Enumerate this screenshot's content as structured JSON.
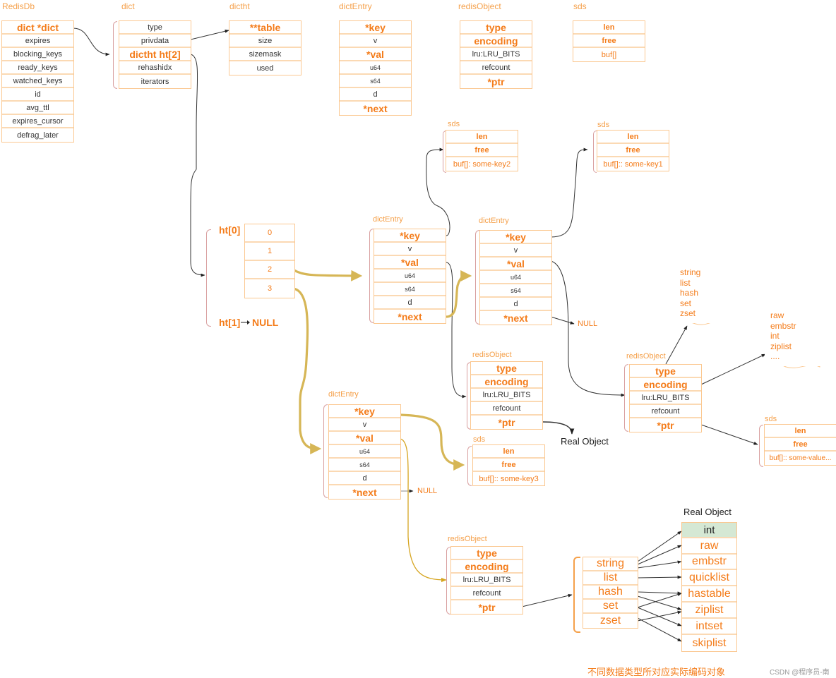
{
  "titles": {
    "redisdb": "RedisDb",
    "dict": "dict",
    "dictht": "dictht",
    "dictentry": "dictEntry",
    "redisobject": "redisObject",
    "sds": "sds"
  },
  "redisdb": [
    "dict  *dict",
    "expires",
    "blocking_keys",
    "ready_keys",
    "watched_keys",
    "id",
    "avg_ttl",
    "expires_cursor",
    "defrag_later"
  ],
  "dict": [
    "type",
    "privdata",
    "dictht ht[2]",
    "rehashidx",
    "iterators"
  ],
  "dictht": [
    "**table",
    "size",
    "sizemask",
    "used"
  ],
  "dictentry": [
    "*key",
    "v",
    "*val",
    "u64",
    "s64",
    "d",
    "*next"
  ],
  "redisobject": [
    "type",
    "encoding",
    "lru:LRU_BITS",
    "refcount",
    "*ptr"
  ],
  "sds": [
    "len",
    "free",
    "buf[]"
  ],
  "sds_key2": {
    "title": "sds",
    "rows": [
      "len",
      "free",
      "buf[]: some-key2"
    ]
  },
  "sds_key1": {
    "title": "sds",
    "rows": [
      "len",
      "free",
      "buf[]:: some-key1"
    ]
  },
  "sds_key3": {
    "title": "sds",
    "rows": [
      "len",
      "free",
      "buf[]:: some-key3"
    ]
  },
  "sds_value": {
    "title": "sds",
    "rows": [
      "len",
      "free",
      "buf[]:: some-value..."
    ]
  },
  "hashtable": {
    "ht0_label": "ht[0]",
    "ht1_label": "ht[1]",
    "null_label": "NULL",
    "buckets": [
      "0",
      "1",
      "2",
      "3"
    ]
  },
  "entry_a": {
    "title": "dictEntry"
  },
  "entry_b": {
    "title": "dictEntry",
    "next_null": "NULL"
  },
  "entry_c": {
    "title": "dictEntry",
    "next_null": "NULL"
  },
  "robj_a": {
    "title": "redisObject",
    "ptr_target": "Real Object"
  },
  "robj_b": {
    "title": "redisObject"
  },
  "robj_c": {
    "title": "redisObject"
  },
  "type_note": [
    "string",
    "list",
    "hash",
    "set",
    "zset"
  ],
  "encoding_note": [
    "raw",
    "embstr",
    "int",
    "ziplist",
    "...."
  ],
  "types_table": [
    "string",
    "list",
    "hash",
    "set",
    "zset"
  ],
  "real_object": {
    "title": "Real Object",
    "rows": [
      "int",
      "raw",
      "embstr",
      "quicklist",
      "hastable",
      "ziplist",
      "intset",
      "skiplist"
    ],
    "highlight_color": "#d5e8d4"
  },
  "footer": "不同数据类型所对应实际编码对象",
  "watermark": "CSDN @程序员-南",
  "colors": {
    "accent": "#f47c1a",
    "border": "#fbc891",
    "gold_arrow": "#d6b656",
    "brace": "#d9a0a0"
  }
}
